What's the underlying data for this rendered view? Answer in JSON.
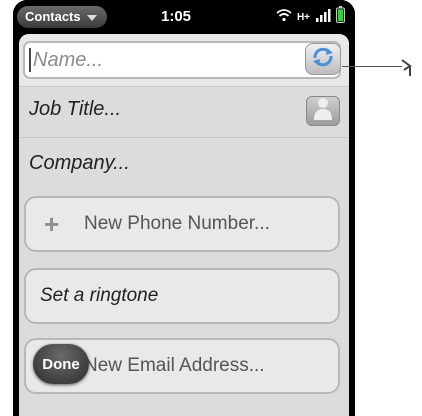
{
  "statusbar": {
    "app_menu_label": "Contacts",
    "time": "1:05",
    "network_label": "H+",
    "icons": [
      "wifi-icon",
      "signal-bars-icon",
      "battery-icon"
    ]
  },
  "form": {
    "name_placeholder": "Name...",
    "job_title_placeholder": "Job Title...",
    "company_placeholder": "Company...",
    "phone_button_label": "New Phone Number...",
    "ringtone_label": "Set a ringtone",
    "email_button_label": "New Email Address...",
    "plus_symbol": "+"
  },
  "footer": {
    "done_label": "Done"
  },
  "colors": {
    "screen_bg": "#dcdcdc",
    "sync_icon": "#4a90d9",
    "battery": "#3ccf3c"
  }
}
